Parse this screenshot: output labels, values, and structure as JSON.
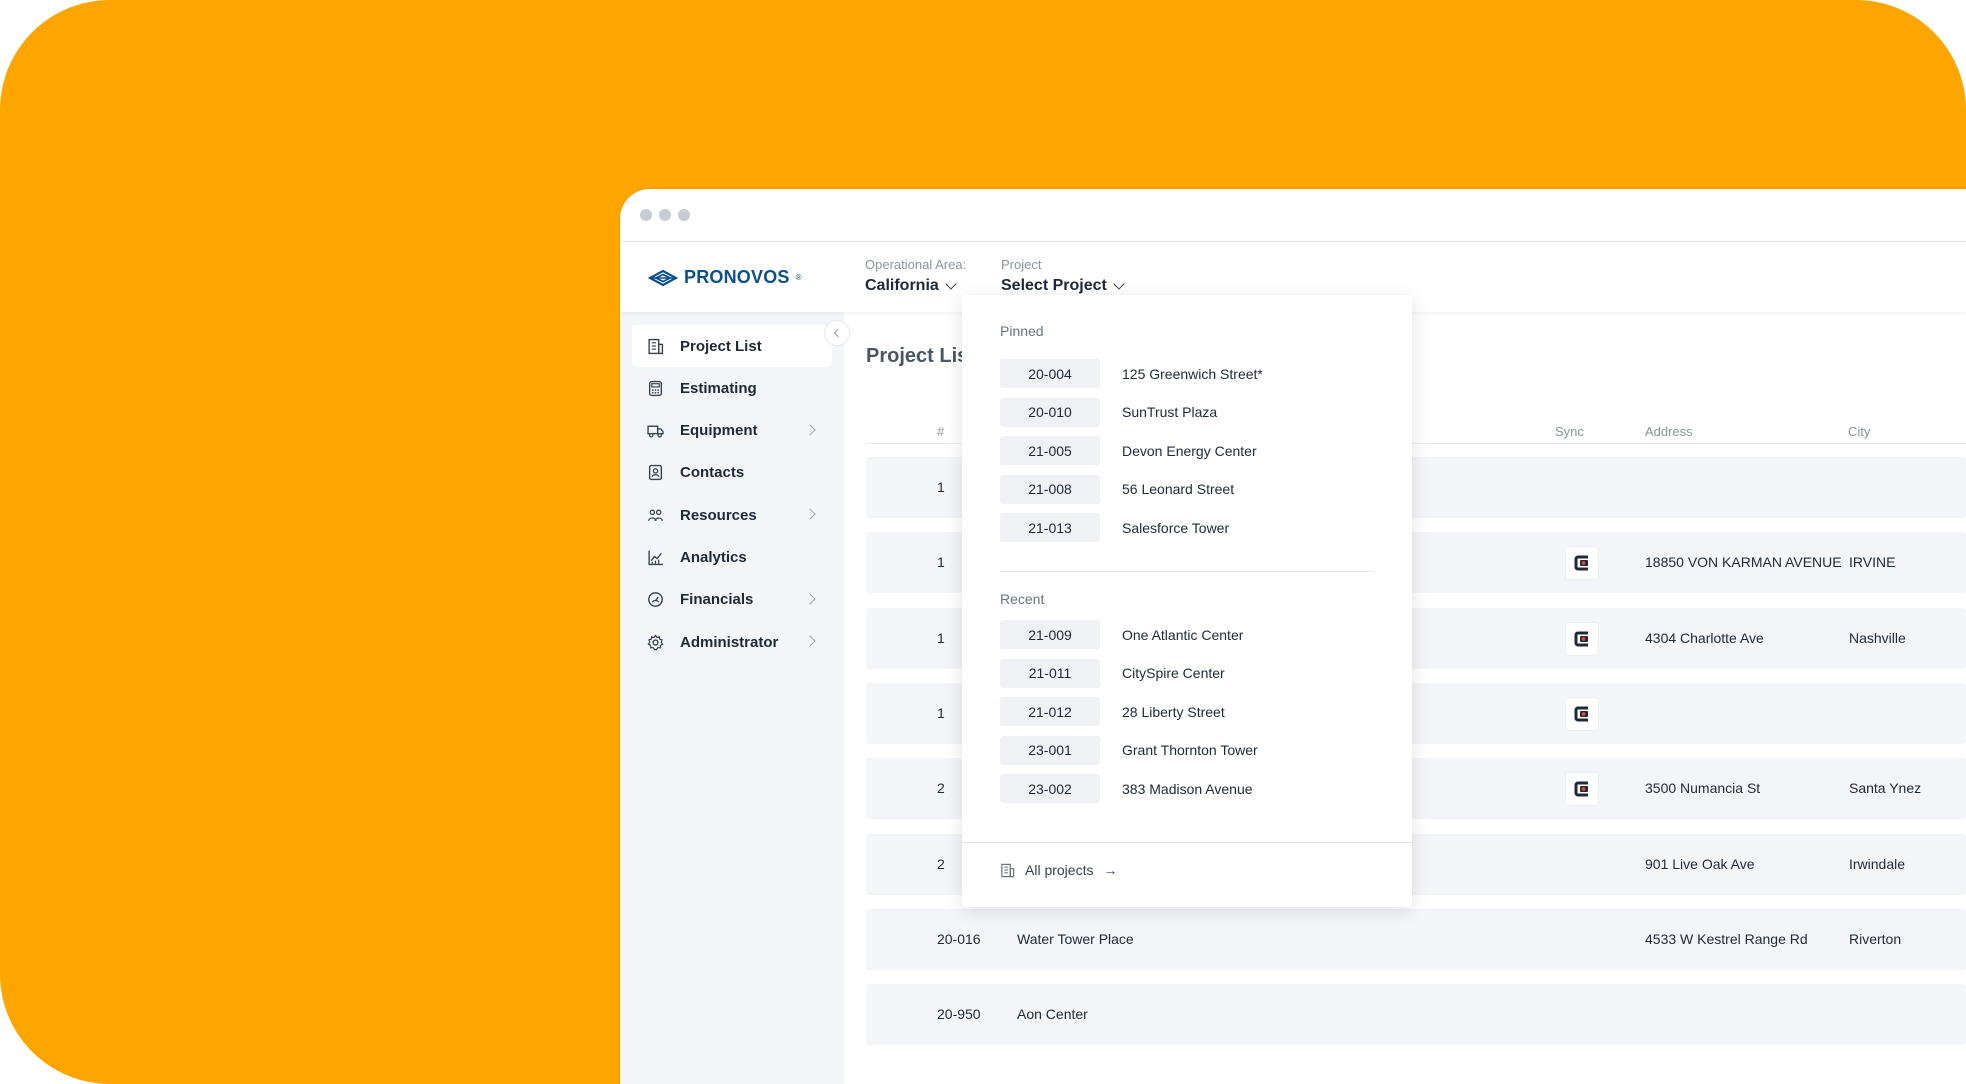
{
  "app": {
    "brand": "PRONOVOS",
    "brand_mark": "®"
  },
  "header": {
    "operational_area_label": "Operational Area:",
    "operational_area_value": "California",
    "project_label": "Project",
    "project_value": "Select Project"
  },
  "sidebar": {
    "items": [
      {
        "label": "Project List",
        "icon": "building-icon",
        "has_children": false,
        "active": true
      },
      {
        "label": "Estimating",
        "icon": "calculator-icon",
        "has_children": false
      },
      {
        "label": "Equipment",
        "icon": "truck-icon",
        "has_children": true
      },
      {
        "label": "Contacts",
        "icon": "contact-card-icon",
        "has_children": false
      },
      {
        "label": "Resources",
        "icon": "people-icon",
        "has_children": true
      },
      {
        "label": "Analytics",
        "icon": "chart-icon",
        "has_children": false
      },
      {
        "label": "Financials",
        "icon": "gauge-icon",
        "has_children": true
      },
      {
        "label": "Administrator",
        "icon": "gear-icon",
        "has_children": true
      }
    ]
  },
  "main": {
    "title": "Project List",
    "columns": {
      "number": "#",
      "sync": "Sync",
      "address": "Address",
      "city": "City"
    },
    "rows": [
      {
        "number": "1",
        "name": "",
        "sync": false,
        "address": "",
        "city": ""
      },
      {
        "number": "1",
        "name": "",
        "sync": true,
        "address": "18850 VON KARMAN AVENUE",
        "city": "IRVINE"
      },
      {
        "number": "1",
        "name": "",
        "sync": true,
        "address": "4304 Charlotte Ave",
        "city": "Nashville"
      },
      {
        "number": "1",
        "name": "",
        "sync": true,
        "address": "",
        "city": ""
      },
      {
        "number": "2",
        "name": "",
        "sync": true,
        "address": "3500 Numancia St",
        "city": "Santa Ynez"
      },
      {
        "number": "2",
        "name": "",
        "sync": false,
        "address": "901 Live Oak Ave",
        "city": "Irwindale"
      },
      {
        "number": "20-016",
        "name": "Water Tower Place",
        "sync": false,
        "address": "4533 W Kestrel Range Rd",
        "city": "Riverton"
      },
      {
        "number": "20-950",
        "name": "Aon Center",
        "sync": false,
        "address": "",
        "city": ""
      }
    ]
  },
  "dropdown": {
    "pinned_label": "Pinned",
    "pinned": [
      {
        "code": "20-004",
        "name": "125 Greenwich Street*"
      },
      {
        "code": "20-010",
        "name": "SunTrust Plaza"
      },
      {
        "code": "21-005",
        "name": "Devon Energy Center"
      },
      {
        "code": "21-008",
        "name": "56 Leonard Street"
      },
      {
        "code": "21-013",
        "name": "Salesforce Tower"
      }
    ],
    "recent_label": "Recent",
    "recent": [
      {
        "code": "21-009",
        "name": "One Atlantic Center"
      },
      {
        "code": "21-011",
        "name": "CitySpire Center"
      },
      {
        "code": "21-012",
        "name": "28 Liberty Street"
      },
      {
        "code": "23-001",
        "name": "Grant Thornton Tower"
      },
      {
        "code": "23-002",
        "name": "383 Madison Avenue"
      }
    ],
    "footer_label": "All projects",
    "footer_arrow": "→"
  },
  "colors": {
    "background": "#FFA500",
    "brand": "#0b4f8f",
    "sync_accent": "#e8452c"
  }
}
